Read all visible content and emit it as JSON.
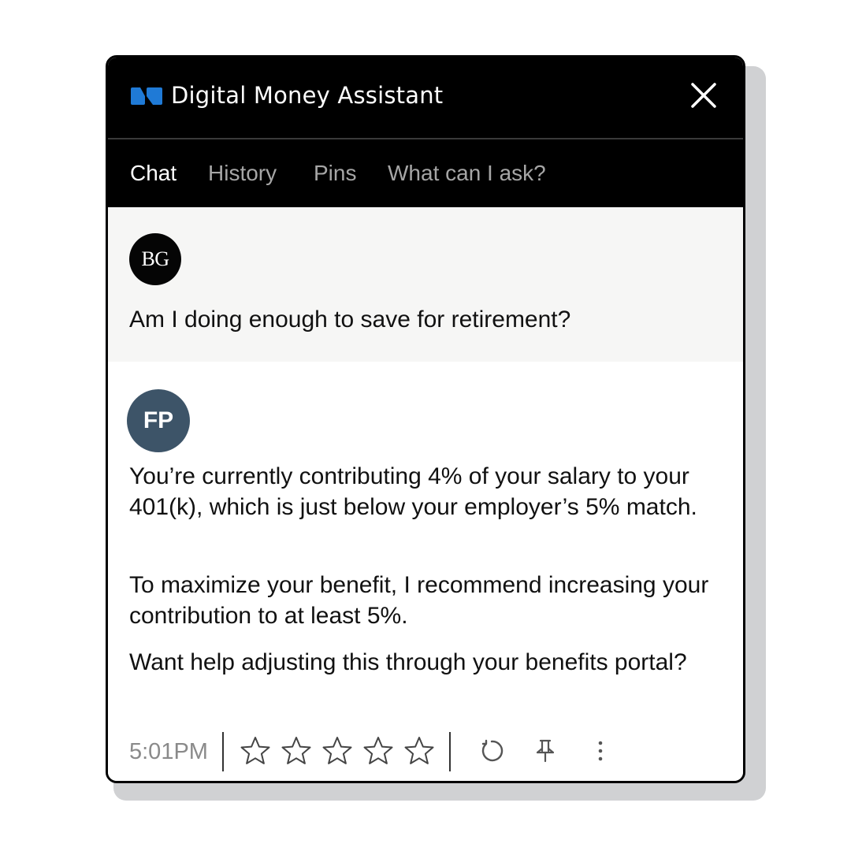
{
  "header": {
    "title": "Digital Money Assistant",
    "logo_icon": "brand-logo-icon",
    "logo_color": "#1f7ad6",
    "close_icon": "close-icon"
  },
  "tabs": [
    {
      "label": "Chat",
      "active": true
    },
    {
      "label": "History",
      "active": false
    },
    {
      "label": "Pins",
      "active": false
    },
    {
      "label": "What can I ask?",
      "active": false
    }
  ],
  "conversation": {
    "user": {
      "initials": "BG",
      "message": "Am I doing enough to save for retirement?"
    },
    "assistant": {
      "initials": "FP",
      "avatar_color": "#3d5468",
      "paragraphs": [
        "You’re currently contributing 4% of your salary to your 401(k), which is just below your employer’s 5% match.",
        "To maximize your benefit, I recommend increasing your contribution to at least 5%.",
        "Want help adjusting this through your benefits portal?"
      ],
      "timestamp": "5:01PM",
      "rating": {
        "value": 0,
        "max": 5
      },
      "actions": [
        "refresh-icon",
        "pin-icon",
        "more-vertical-icon"
      ]
    }
  }
}
